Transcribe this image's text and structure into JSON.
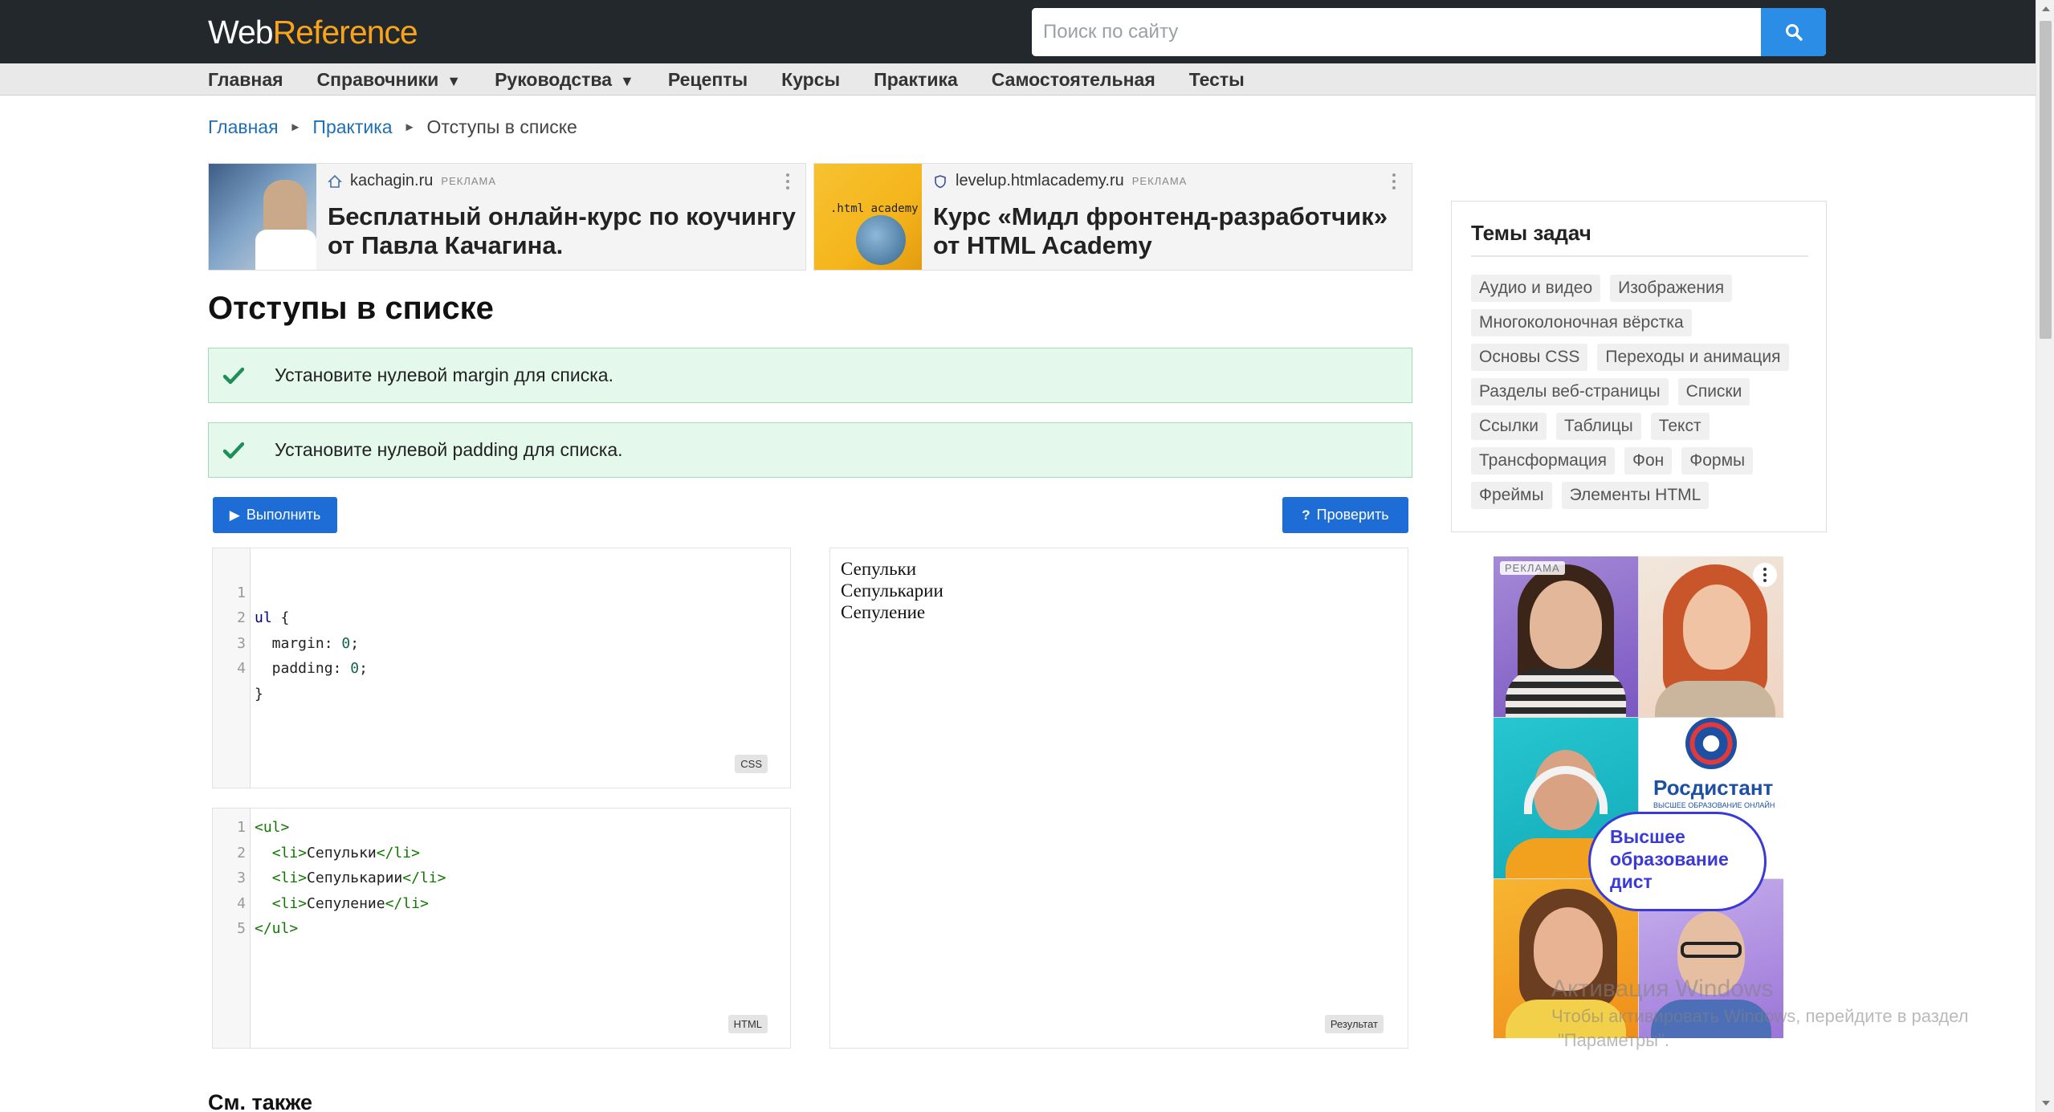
{
  "header": {
    "logo_web": "Web",
    "logo_ref": "Reference",
    "search_placeholder": "Поиск по сайту",
    "search_icon": "search-icon"
  },
  "nav": {
    "items": [
      {
        "label": "Главная",
        "dropdown": false
      },
      {
        "label": "Справочники",
        "dropdown": true
      },
      {
        "label": "Руководства",
        "dropdown": true
      },
      {
        "label": "Рецепты",
        "dropdown": false
      },
      {
        "label": "Курсы",
        "dropdown": false
      },
      {
        "label": "Практика",
        "dropdown": false
      },
      {
        "label": "Самостоятельная",
        "dropdown": false
      },
      {
        "label": "Тесты",
        "dropdown": false
      }
    ],
    "caret": "▼"
  },
  "breadcrumb": {
    "home": "Главная",
    "section": "Практика",
    "current": "Отступы в списке",
    "separator": "►"
  },
  "ads": [
    {
      "domain": "kachagin.ru",
      "label": "РЕКЛАМА",
      "title": "Бесплатный онлайн-курс по коучингу от Павла Качагина."
    },
    {
      "domain": "levelup.htmlacademy.ru",
      "label": "РЕКЛАМА",
      "title": "Курс «Мидл фронтенд-разработчик» от HTML Academy",
      "thumb_text": ".html academy"
    }
  ],
  "page": {
    "title": "Отступы в списке",
    "see_also": "См. также"
  },
  "tasks": [
    {
      "text": "Установите нулевой margin для списка.",
      "status": "done"
    },
    {
      "text": "Установите нулевой padding для списка.",
      "status": "done"
    }
  ],
  "buttons": {
    "run_icon": "▶",
    "run": "Выполнить",
    "check_icon": "?",
    "check": "Проверить"
  },
  "css_editor": {
    "badge": "CSS",
    "line_numbers": [
      "1",
      "2",
      "3",
      "4"
    ],
    "lines": [
      {
        "sel": "ul",
        "rest": " {"
      },
      {
        "prop": "  margin",
        "colon": ": ",
        "num": "0",
        "end": ";"
      },
      {
        "prop": "  padding",
        "colon": ": ",
        "num": "0",
        "end": ";"
      },
      {
        "rest": "}"
      }
    ]
  },
  "html_editor": {
    "badge": "HTML",
    "line_numbers": [
      "1",
      "2",
      "3",
      "4",
      "5"
    ],
    "lines": [
      {
        "indent": "",
        "open": "<ul>",
        "text": "",
        "close": ""
      },
      {
        "indent": "  ",
        "open": "<li>",
        "text": "Сепульки",
        "close": "</li>"
      },
      {
        "indent": "  ",
        "open": "<li>",
        "text": "Сепулькарии",
        "close": "</li>"
      },
      {
        "indent": "  ",
        "open": "<li>",
        "text": "Сепуление",
        "close": "</li>"
      },
      {
        "indent": "",
        "open": "</ul>",
        "text": "",
        "close": ""
      }
    ]
  },
  "result": {
    "badge": "Результат",
    "items": [
      "Сепульки",
      "Сепулькарии",
      "Сепуление"
    ]
  },
  "sidebar": {
    "title": "Темы задач",
    "topics": [
      "Аудио и видео",
      "Изображения",
      "Многоколоночная вёрстка",
      "Основы CSS",
      "Переходы и анимация",
      "Разделы веб-страницы",
      "Списки",
      "Ссылки",
      "Таблицы",
      "Текст",
      "Трансформация",
      "Фон",
      "Формы",
      "Фреймы",
      "Элементы HTML"
    ]
  },
  "banner": {
    "label": "РЕКЛАМА",
    "brand": "Росдистант",
    "brand_sub": "ВЫСШЕЕ ОБРАЗОВАНИЕ ОНЛАЙН",
    "bubble": [
      "Высшее",
      "образование",
      "дист"
    ]
  },
  "watermark": {
    "line1": "Активация Windows",
    "line2": "Чтобы активировать Windows, перейдите в раздел",
    "line3": "\"Параметры\"."
  },
  "colors": {
    "header_bg": "#23282d",
    "accent": "#f8a31a",
    "link": "#1f6fb4",
    "button": "#1e6dd6",
    "success_bg": "#e4f8ec",
    "success_icon": "#1f8f5a"
  }
}
